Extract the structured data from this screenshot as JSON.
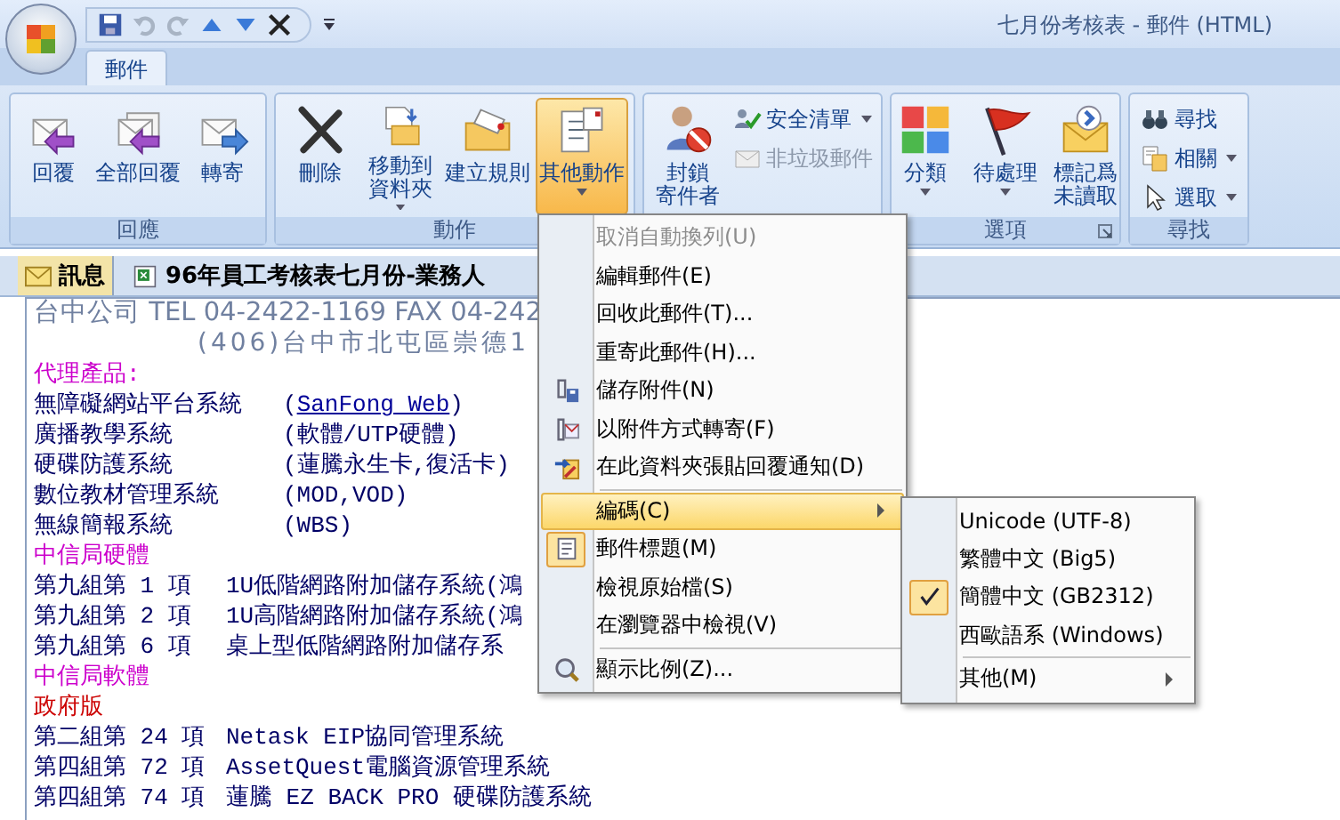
{
  "window": {
    "title": "七月份考核表 - 郵件 (HTML)"
  },
  "tabs": [
    {
      "label": "郵件",
      "selected": true
    }
  ],
  "ribbon": {
    "groups": [
      {
        "label": "回應",
        "buttons": [
          {
            "kind": "large",
            "label": "回覆",
            "dropdown": false,
            "selected": false,
            "disabled": false
          },
          {
            "kind": "large",
            "label": "全部回覆",
            "dropdown": false,
            "selected": false,
            "disabled": false
          },
          {
            "kind": "large",
            "label": "轉寄",
            "dropdown": false,
            "selected": false,
            "disabled": false
          }
        ]
      },
      {
        "label": "動作",
        "buttons": [
          {
            "kind": "large",
            "label": "刪除",
            "dropdown": false,
            "selected": false,
            "disabled": false
          },
          {
            "kind": "large",
            "lines": [
              "移動到",
              "資料夾"
            ],
            "dropdown": true,
            "selected": false,
            "disabled": false
          },
          {
            "kind": "large",
            "label": "建立規則",
            "dropdown": false,
            "selected": false,
            "disabled": false
          },
          {
            "kind": "large",
            "label": "其他動作",
            "dropdown": true,
            "selected": true,
            "disabled": false
          }
        ]
      },
      {
        "buttons": [
          {
            "kind": "large",
            "lines": [
              "封鎖",
              "寄件者"
            ],
            "dropdown": false,
            "selected": false,
            "disabled": false
          },
          {
            "kind": "small",
            "label": "安全清單",
            "dropdown": true,
            "selected": false,
            "disabled": false
          },
          {
            "kind": "small",
            "label": "非垃圾郵件",
            "dropdown": false,
            "selected": false,
            "disabled": true
          }
        ]
      },
      {
        "label": "選項",
        "launcher": true,
        "buttons": [
          {
            "kind": "large",
            "label": "分類",
            "dropdown": true,
            "selected": false,
            "disabled": false
          },
          {
            "kind": "large",
            "label": "待處理",
            "dropdown": true,
            "selected": false,
            "disabled": false
          },
          {
            "kind": "large",
            "lines": [
              "標記爲",
              "未讀取"
            ],
            "dropdown": false,
            "selected": false,
            "disabled": false
          }
        ]
      },
      {
        "label": "尋找",
        "buttons": [
          {
            "kind": "small",
            "label": "尋找",
            "dropdown": false,
            "selected": false,
            "disabled": false
          },
          {
            "kind": "small",
            "label": "相關",
            "dropdown": true,
            "selected": false,
            "disabled": false
          },
          {
            "kind": "small",
            "label": "選取",
            "dropdown": true,
            "selected": false,
            "disabled": false
          }
        ]
      }
    ]
  },
  "message_tabs": [
    {
      "kind": "message",
      "label": "訊息",
      "selected": true
    },
    {
      "kind": "attachment",
      "label": "96年員工考核表七月份-業務人",
      "selected": false
    }
  ],
  "body": [
    {
      "kind": "contact",
      "text": "台中公司 TEL 04-2422-1169  FAX 04-242"
    },
    {
      "kind": "address",
      "text": "(406)台中市北屯區崇德1"
    },
    {
      "kind": "heading",
      "text": "代理產品:",
      "color": "#cc00cc"
    },
    {
      "kind": "product",
      "label": "無障礙網站平台系統",
      "open": "(",
      "link": "SanFong Web",
      "close": ")"
    },
    {
      "kind": "product",
      "label": "廣播教學系統",
      "open": "(軟體/UTP硬體)"
    },
    {
      "kind": "product",
      "label": "硬碟防護系統",
      "open": "(蓮騰永生卡,復活卡)"
    },
    {
      "kind": "product",
      "label": "數位教材管理系統",
      "open": "(MOD,VOD)"
    },
    {
      "kind": "product",
      "label": "無線簡報系統",
      "open": "(WBS)"
    },
    {
      "kind": "heading",
      "text": "中信局硬體",
      "color": "#cc00cc"
    },
    {
      "kind": "item",
      "label": "第九組第 1 項",
      "value": "1U低階網路附加儲存系統(鴻"
    },
    {
      "kind": "item",
      "label": "第九組第 2 項",
      "value": "1U高階網路附加儲存系統(鴻"
    },
    {
      "kind": "item",
      "label": "第九組第 6 項",
      "value": "桌上型低階網路附加儲存系"
    },
    {
      "kind": "heading",
      "text": "中信局軟體",
      "color": "#cc00cc"
    },
    {
      "kind": "heading",
      "text": "政府版",
      "color": "#cc0000"
    },
    {
      "kind": "item",
      "label": "第二組第 24 項",
      "value": "Netask EIP協同管理系統"
    },
    {
      "kind": "item",
      "label": "第四組第 72 項",
      "value": "AssetQuest電腦資源管理系統"
    },
    {
      "kind": "item",
      "label": "第四組第 74 項",
      "value": "蓮騰 EZ BACK PRO 硬碟防護系統"
    }
  ],
  "menu": [
    {
      "kind": "item",
      "label": "取消自動換列(U)",
      "disabled": true,
      "selected": false,
      "checked": false
    },
    {
      "kind": "item",
      "label": "編輯郵件(E)",
      "disabled": false,
      "selected": false,
      "checked": false
    },
    {
      "kind": "item",
      "label": "回收此郵件(T)...",
      "disabled": false,
      "selected": false,
      "checked": false
    },
    {
      "kind": "item",
      "label": "重寄此郵件(H)...",
      "disabled": false,
      "selected": false,
      "checked": false
    },
    {
      "kind": "item",
      "label": "儲存附件(N)",
      "disabled": false,
      "selected": false,
      "checked": false
    },
    {
      "kind": "item",
      "label": "以附件方式轉寄(F)",
      "disabled": false,
      "selected": false,
      "checked": false
    },
    {
      "kind": "item",
      "label": "在此資料夾張貼回覆通知(D)",
      "disabled": false,
      "selected": false,
      "checked": false
    },
    {
      "kind": "separator"
    },
    {
      "kind": "submenu",
      "label": "編碼(C)",
      "disabled": false,
      "selected": true,
      "checked": false
    },
    {
      "kind": "item",
      "label": "郵件標題(M)",
      "disabled": false,
      "selected": false,
      "checked": true
    },
    {
      "kind": "item",
      "label": "檢視原始檔(S)",
      "disabled": false,
      "selected": false,
      "checked": false
    },
    {
      "kind": "item",
      "label": "在瀏覽器中檢視(V)",
      "disabled": false,
      "selected": false,
      "checked": false
    },
    {
      "kind": "separator"
    },
    {
      "kind": "item",
      "label": "顯示比例(Z)...",
      "disabled": false,
      "selected": false,
      "checked": false
    }
  ],
  "submenu": [
    {
      "kind": "item",
      "label": "Unicode (UTF-8)",
      "checked": false
    },
    {
      "kind": "item",
      "label": "繁體中文 (Big5)",
      "checked": false
    },
    {
      "kind": "item",
      "label": "簡體中文 (GB2312)",
      "checked": true
    },
    {
      "kind": "item",
      "label": "西歐語系 (Windows)",
      "checked": false
    },
    {
      "kind": "separator"
    },
    {
      "kind": "submenu",
      "label": "其他(M)",
      "checked": false
    }
  ]
}
